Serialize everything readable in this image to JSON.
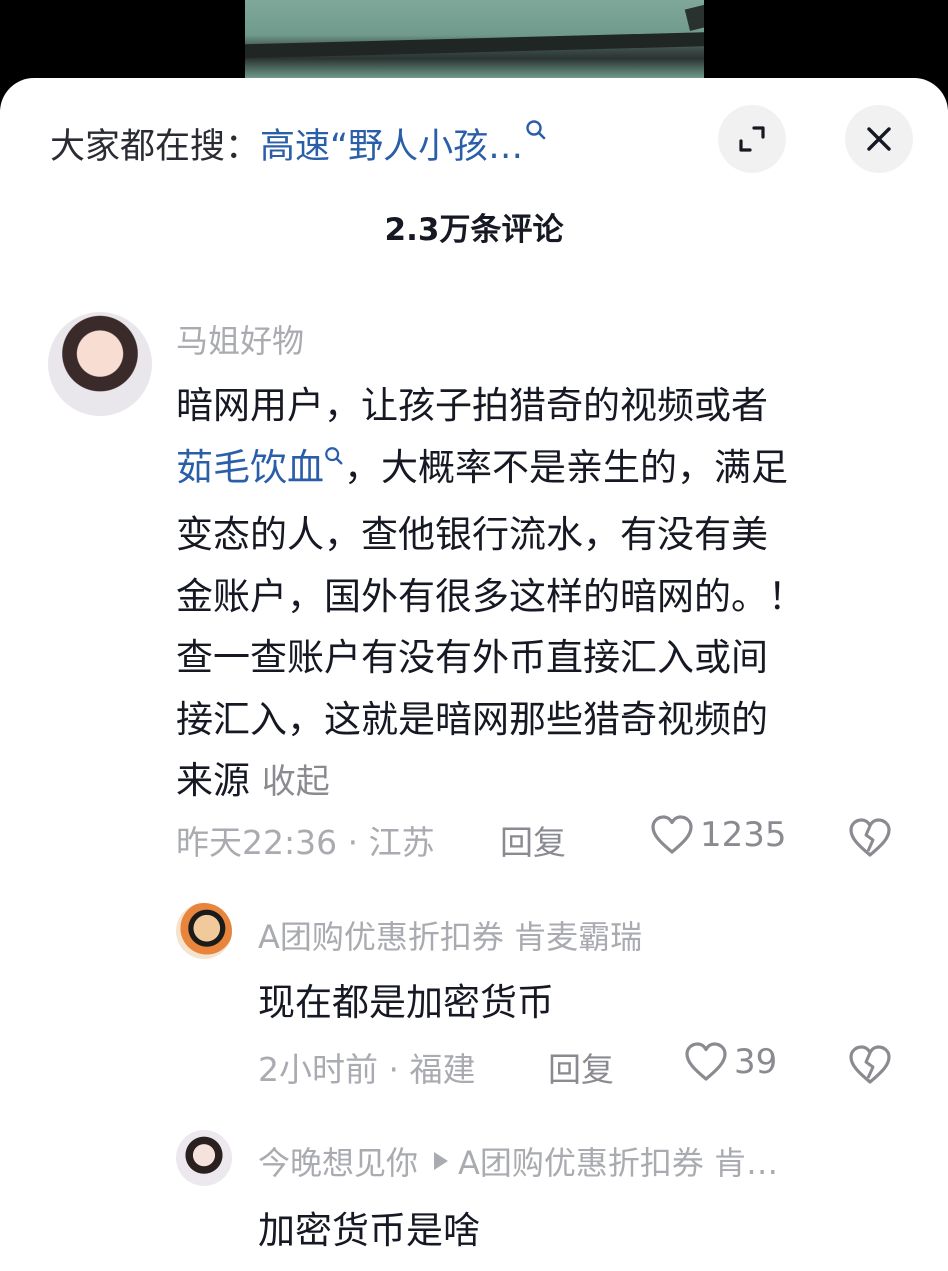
{
  "header": {
    "search_prefix": "大家都在搜：",
    "search_term": "高速“野人小孩…",
    "expand_label": "expand",
    "close_label": "close"
  },
  "comment_count": "2.3万条评论",
  "comment": {
    "username": "马姐好物",
    "lines": [
      "暗网用户，让孩子拍猎奇的视频或者",
      "，大概率不是亲生的，满足",
      "变态的人，查他银行流水，有没有美",
      "金账户，国外有很多这样的暗网的。！",
      "查一查账户有没有外币直接汇入或间",
      "接汇入，这就是暗网那些猎奇视频的",
      "来源"
    ],
    "link_term": "茹毛饮血",
    "collapse_label": "收起",
    "time_location": "昨天22:36 · 江苏",
    "reply_label": "回复",
    "likes": "1235"
  },
  "replies": [
    {
      "username": "A团购优惠折扣券 肯麦霸瑞",
      "text": "现在都是加密货币",
      "time_location": "2小时前 · 福建",
      "reply_label": "回复",
      "likes": "39"
    },
    {
      "username": "今晚想见你",
      "reply_to": "A团购优惠折扣券 肯…",
      "text": "加密货币是啥"
    }
  ],
  "icons": {
    "search": "search-icon",
    "expand": "expand-icon",
    "close": "close-icon",
    "heart": "heart-icon",
    "dislike": "broken-heart-icon"
  },
  "colors": {
    "link": "#2a5ea8",
    "muted": "#a9abb0",
    "text": "#161823"
  }
}
